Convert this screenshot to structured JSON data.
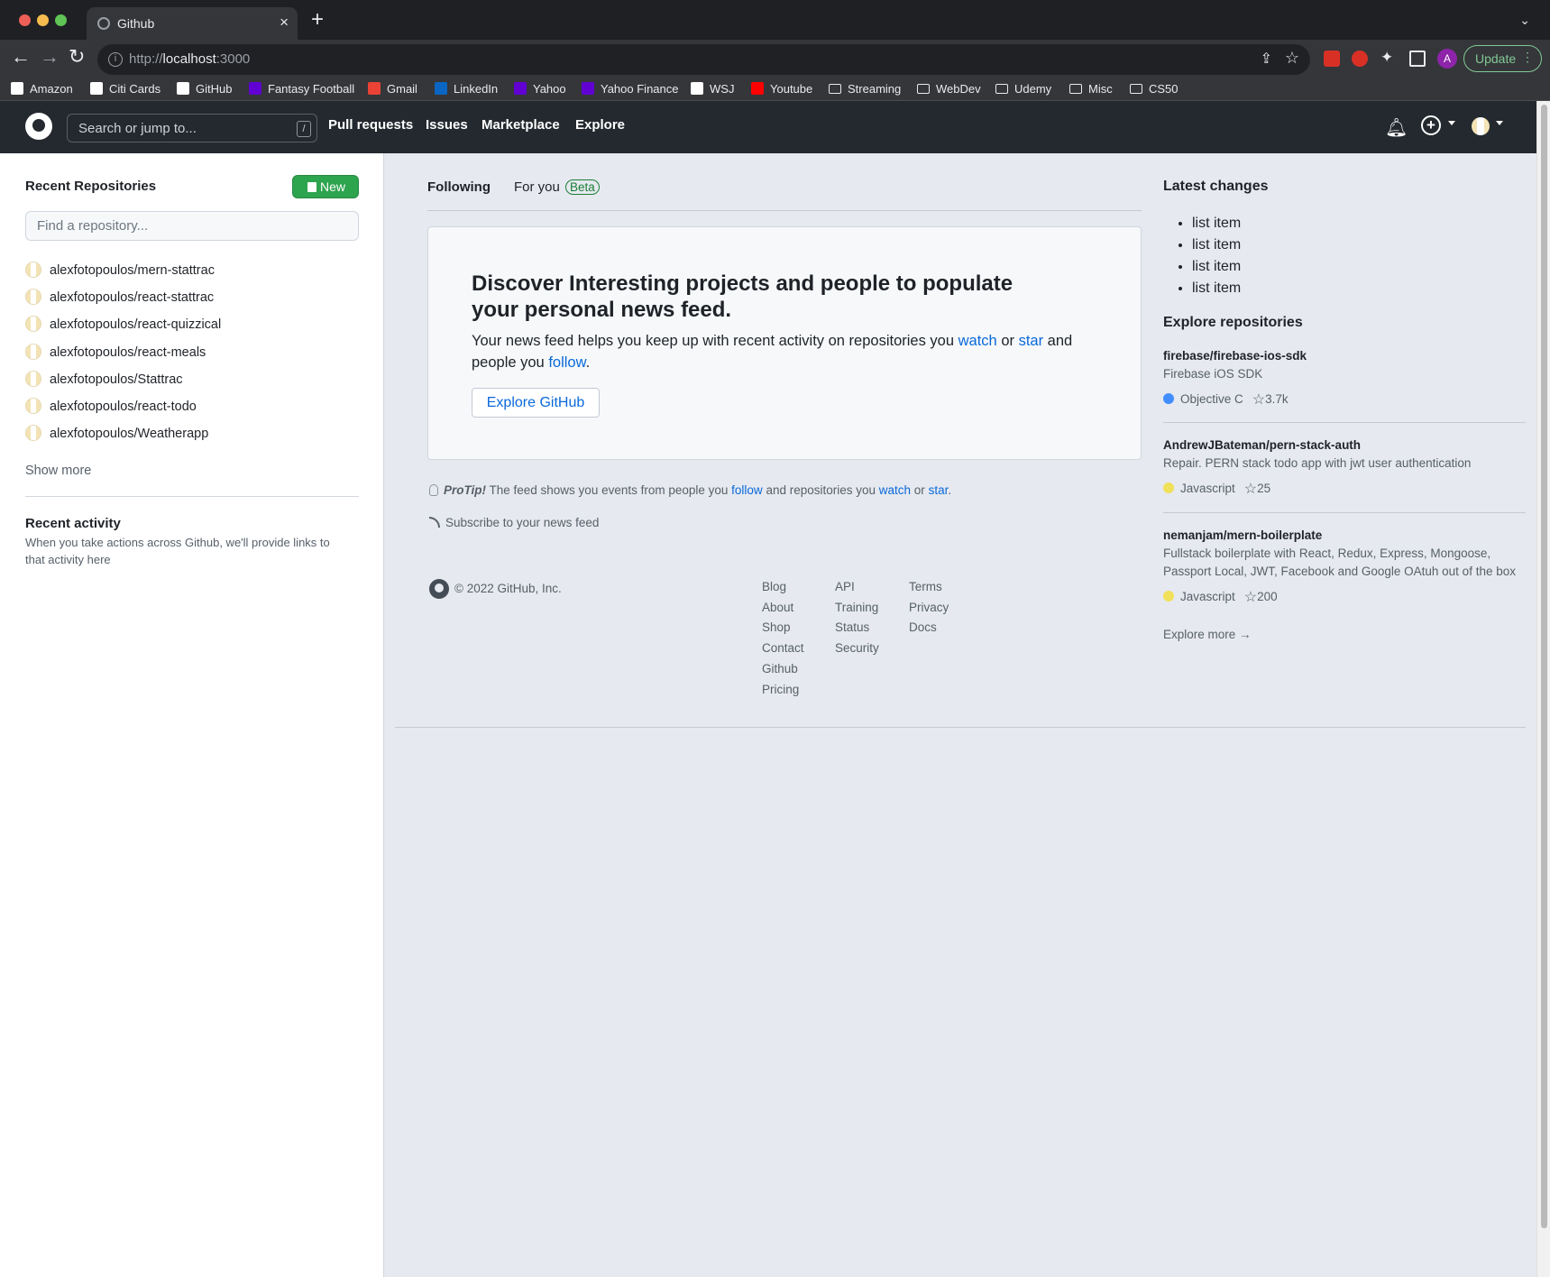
{
  "browser": {
    "tab_title": "Github",
    "url_prefix": "http://",
    "url_host": "localhost",
    "url_port": ":3000",
    "profile_initial": "A",
    "update_label": "Update",
    "bookmarks": [
      {
        "label": "Amazon",
        "icon": "amazon-icon",
        "color": "#ffffff"
      },
      {
        "label": "Citi Cards",
        "icon": "citi-icon",
        "color": "#ffffff"
      },
      {
        "label": "GitHub",
        "icon": "github-icon",
        "color": "#ffffff"
      },
      {
        "label": "Fantasy Football",
        "icon": "yahoo-icon",
        "color": "#6001d2"
      },
      {
        "label": "Gmail",
        "icon": "gmail-icon",
        "color": "#ea4335"
      },
      {
        "label": "LinkedIn",
        "icon": "linkedin-icon",
        "color": "#0a66c2"
      },
      {
        "label": "Yahoo",
        "icon": "yahoo-icon",
        "color": "#6001d2"
      },
      {
        "label": "Yahoo Finance",
        "icon": "yahoo-icon",
        "color": "#6001d2"
      },
      {
        "label": "WSJ",
        "icon": "wsj-icon",
        "color": "#ffffff"
      },
      {
        "label": "Youtube",
        "icon": "youtube-icon",
        "color": "#ff0000"
      },
      {
        "label": "Streaming",
        "icon": "folder-icon",
        "color": "folder"
      },
      {
        "label": "WebDev",
        "icon": "folder-icon",
        "color": "folder"
      },
      {
        "label": "Udemy",
        "icon": "folder-icon",
        "color": "folder"
      },
      {
        "label": "Misc",
        "icon": "folder-icon",
        "color": "folder"
      },
      {
        "label": "CS50",
        "icon": "folder-icon",
        "color": "folder"
      }
    ]
  },
  "header": {
    "search_placeholder": "Search or jump to...",
    "search_shortcut": "/",
    "nav": [
      "Pull requests",
      "Issues",
      "Marketplace",
      "Explore"
    ]
  },
  "sidebar": {
    "title": "Recent Repositories",
    "new_button": "New",
    "filter_placeholder": "Find a repository...",
    "repos": [
      "alexfotopoulos/mern-stattrac",
      "alexfotopoulos/react-stattrac",
      "alexfotopoulos/react-quizzical",
      "alexfotopoulos/react-meals",
      "alexfotopoulos/Stattrac",
      "alexfotopoulos/react-todo",
      "alexfotopoulos/Weatherapp"
    ],
    "show_more": "Show more",
    "recent_activity_title": "Recent activity",
    "recent_activity_text": "When you take actions across Github, we'll provide links to that activity here"
  },
  "feed": {
    "tab_following": "Following",
    "tab_for_you": "For you",
    "beta_badge": "Beta",
    "discover_title": "Discover Interesting projects and people to populate your personal news feed.",
    "discover_text_1": "Your news feed helps you keep up with recent activity on repositories you ",
    "discover_link_watch": "watch",
    "discover_text_2": " or ",
    "discover_link_star": "star",
    "discover_text_3": " and people you ",
    "discover_link_follow": "follow",
    "discover_text_4": ".",
    "explore_button": "Explore GitHub",
    "protip_label": "ProTip!",
    "protip_text_1": " The feed shows you events from people you ",
    "protip_link_follow": "follow",
    "protip_text_2": " and repositories you ",
    "protip_link_watch": "watch",
    "protip_text_3": " or ",
    "protip_link_star": "star",
    "protip_text_4": ".",
    "subscribe": "Subscribe to your news feed"
  },
  "footer": {
    "copyright": "© 2022 GitHub, Inc.",
    "col1": [
      "Blog",
      "About",
      "Shop",
      "Contact",
      "Github",
      "Pricing"
    ],
    "col2": [
      "API",
      "Training",
      "Status",
      "Security"
    ],
    "col3": [
      "Terms",
      "Privacy",
      "Docs"
    ]
  },
  "right": {
    "latest_changes_title": "Latest changes",
    "latest_changes": [
      "list item",
      "list item",
      "list item",
      "list item"
    ],
    "explore_title": "Explore repositories",
    "explore_repos": [
      {
        "name": "firebase/firebase-ios-sdk",
        "description": "Firebase iOS SDK",
        "language": "Objective C",
        "lang_color": "#438eff",
        "stars": "3.7k"
      },
      {
        "name": "AndrewJBateman/pern-stack-auth",
        "description": "Repair. PERN stack todo app with jwt user authentication",
        "language": "Javascript",
        "lang_color": "#f1e05a",
        "stars": "25"
      },
      {
        "name": "nemanjam/mern-boilerplate",
        "description": "Fullstack boilerplate with React, Redux, Express, Mongoose, Passport Local, JWT, Facebook and Google OAtuh out of the box",
        "language": "Javascript",
        "lang_color": "#f1e05a",
        "stars": "200"
      }
    ],
    "explore_more": "Explore more →"
  },
  "colors": {
    "accent_green": "#2da44e",
    "link_blue": "#0969da",
    "header_bg": "#24292f"
  }
}
